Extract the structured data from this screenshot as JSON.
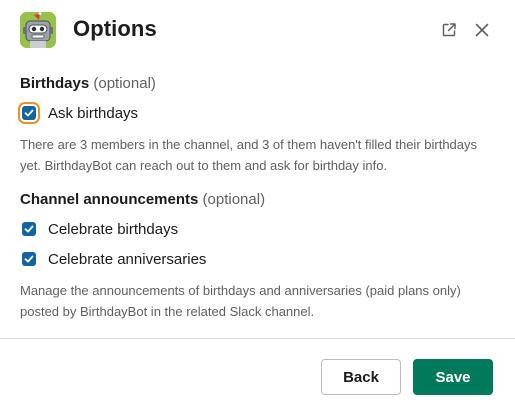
{
  "header": {
    "title": "Options",
    "icons": {
      "app": "birthdaybot-robot-icon",
      "external": "external-link-icon",
      "close": "close-icon"
    }
  },
  "birthdays": {
    "heading": "Birthdays",
    "optional": "(optional)",
    "ask_label": "Ask birthdays",
    "ask_checked": true,
    "help": "There are 3 members in the channel, and 3 of them haven't filled their birthdays yet. BirthdayBot can reach out to them and ask for birthday info."
  },
  "announcements": {
    "heading": "Channel announcements",
    "optional": "(optional)",
    "birthdays_label": "Celebrate birthdays",
    "birthdays_checked": true,
    "anniversaries_label": "Celebrate anniversaries",
    "anniversaries_checked": true,
    "help": "Manage the announcements of birthdays and anniversaries (paid plans only) posted by BirthdayBot in the related Slack channel."
  },
  "footer": {
    "back_label": "Back",
    "save_label": "Save"
  },
  "colors": {
    "checkbox": "#1264a3",
    "focus_ring": "#e8912d",
    "save_button": "#007a5a",
    "app_icon_bg": "#96c24a"
  }
}
